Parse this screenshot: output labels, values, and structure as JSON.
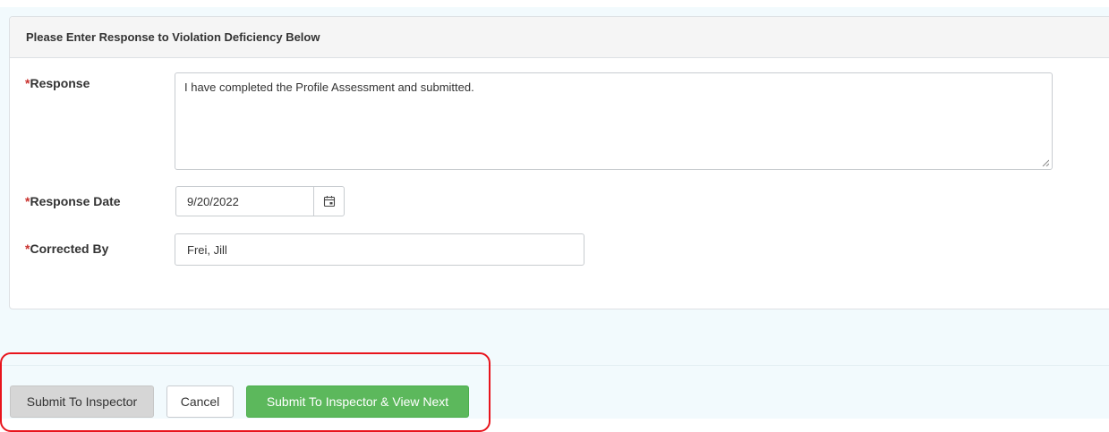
{
  "panel": {
    "heading": "Please Enter Response to Violation Deficiency Below"
  },
  "form": {
    "required_marker": "*",
    "response": {
      "label": "Response",
      "value": "I have completed the Profile Assessment and submitted."
    },
    "response_date": {
      "label": "Response Date",
      "value": "9/20/2022",
      "icon": "calendar-icon"
    },
    "corrected_by": {
      "label": "Corrected By",
      "value": "Frei, Jill"
    }
  },
  "actions": {
    "submit_label": "Submit To Inspector",
    "cancel_label": "Cancel",
    "submit_next_label": "Submit To Inspector & View Next"
  },
  "colors": {
    "required": "#c9302c",
    "primary_green": "#5cb85c",
    "highlight_red": "#e8141c",
    "page_bg": "#f2fafd"
  }
}
